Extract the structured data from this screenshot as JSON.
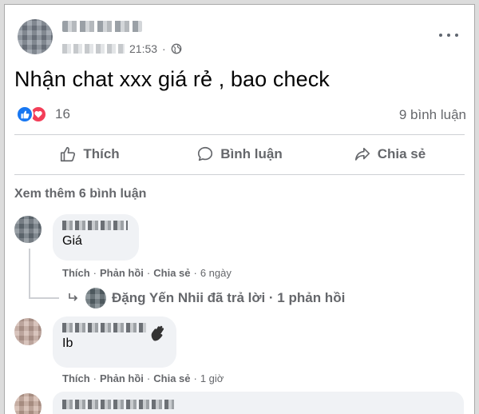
{
  "post": {
    "author_label": "",
    "time": "21:53",
    "text": "Nhận chat xxx giá rẻ , bao check",
    "reaction_count": "16",
    "comment_count": "9 bình luận"
  },
  "actions": {
    "like": "Thích",
    "comment": "Bình luận",
    "share": "Chia sẻ"
  },
  "see_more": "Xem thêm 6 bình luận",
  "comments": [
    {
      "text": "Giá",
      "actions": [
        "Thích",
        "Phản hồi",
        "Chia sẻ"
      ],
      "separator": "·",
      "age": "6 ngày",
      "reply_summary": "Đặng Yến Nhii đã trả lời · 1 phản hồi"
    },
    {
      "text": "Ib",
      "actions": [
        "Thích",
        "Phản hồi",
        "Chia sẻ"
      ],
      "separator": "·",
      "age": "1 giờ"
    }
  ],
  "colors": {
    "like_blue": "#1877f2",
    "love_red": "#f33e58",
    "secondary_text": "#65676b",
    "bubble_bg": "#f0f2f5"
  },
  "icons": [
    "globe-icon",
    "more-icon",
    "like-icon",
    "comment-icon",
    "share-icon",
    "reply-arrow-icon",
    "wave-hand-icon"
  ]
}
